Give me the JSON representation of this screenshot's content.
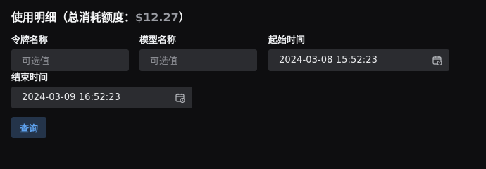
{
  "header": {
    "title_prefix": "使用明细（总消耗额度：",
    "amount": "$12.27",
    "title_suffix": "）"
  },
  "filters": {
    "token_name": {
      "label": "令牌名称",
      "placeholder": "可选值"
    },
    "model_name": {
      "label": "模型名称",
      "placeholder": "可选值"
    },
    "start_time": {
      "label": "起始时间",
      "value": "2024-03-08 15:52:23",
      "icon": "calendar-icon"
    },
    "end_time": {
      "label": "结束时间",
      "value": "2024-03-09 16:52:23",
      "icon": "calendar-icon"
    }
  },
  "actions": {
    "query_label": "查询"
  },
  "colors": {
    "accent": "#5fa3f0",
    "background": "#0e0e10",
    "field": "#2b2c30"
  }
}
